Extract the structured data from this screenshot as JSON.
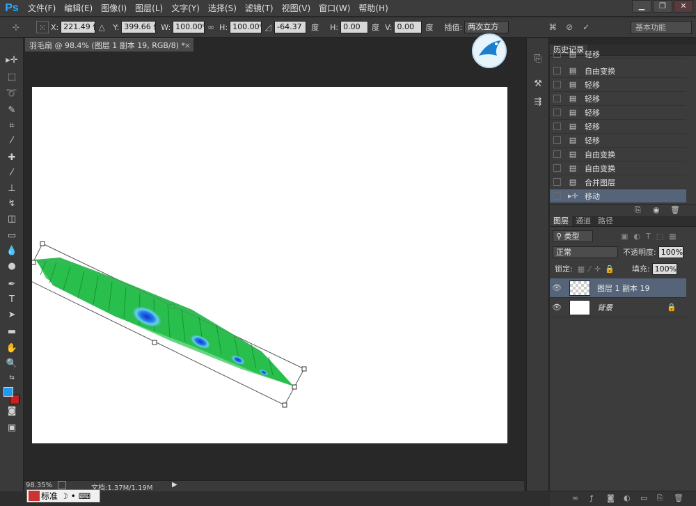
{
  "app": {
    "logo": "Ps"
  },
  "menu": [
    "文件(F)",
    "编辑(E)",
    "图像(I)",
    "图层(L)",
    "文字(Y)",
    "选择(S)",
    "滤镜(T)",
    "视图(V)",
    "窗口(W)",
    "帮助(H)"
  ],
  "window_controls": [
    "▁",
    "❐",
    "✕"
  ],
  "options": {
    "x_label": "X:",
    "x_value": "221.49 像",
    "y_label": "Y:",
    "y_value": "399.66 像",
    "w_label": "W:",
    "w_value": "100.00%",
    "h_label": "H:",
    "h_value": "100.00%",
    "angle_value": "-64.37",
    "angle_unit": "度",
    "hskew_label": "H:",
    "hskew_value": "0.00",
    "hskew_unit": "度",
    "vskew_label": "V:",
    "vskew_value": "0.00",
    "vskew_unit": "度",
    "interp_label": "插值:",
    "interp_value": "两次立方",
    "workspace": "基本功能"
  },
  "document": {
    "tab_title": "羽毛扇 @ 98.4% (图层 1 副本 19, RGB/8) *",
    "tab_close": "×"
  },
  "status": {
    "zoom": "98.35%",
    "doc_info": "文档:1.37M/1.19M"
  },
  "ime": {
    "mode": "标准"
  },
  "history": {
    "tab": "历史记录",
    "rows": [
      {
        "label": "轻移",
        "selected": false
      },
      {
        "label": "自由变换",
        "selected": false
      },
      {
        "label": "轻移",
        "selected": false
      },
      {
        "label": "轻移",
        "selected": false
      },
      {
        "label": "轻移",
        "selected": false
      },
      {
        "label": "轻移",
        "selected": false
      },
      {
        "label": "轻移",
        "selected": false
      },
      {
        "label": "自由变换",
        "selected": false
      },
      {
        "label": "自由变换",
        "selected": false
      },
      {
        "label": "合并图层",
        "selected": false
      },
      {
        "label": "移动",
        "selected": true
      }
    ]
  },
  "layers": {
    "tabs": [
      "图层",
      "通道",
      "路径"
    ],
    "filter_kind": "类型",
    "blend_mode": "正常",
    "opacity_label": "不透明度:",
    "opacity_value": "100%",
    "lock_label": "锁定:",
    "fill_label": "填充:",
    "fill_value": "100%",
    "items": [
      {
        "name": "图层 1 副本 19",
        "selected": true
      },
      {
        "name": "背景",
        "selected": false
      }
    ]
  },
  "colors": {
    "foreground": "#1e9bf0",
    "background": "#c8201a",
    "selection": "#566479"
  }
}
